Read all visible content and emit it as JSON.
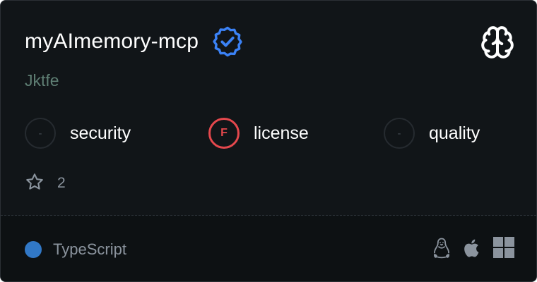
{
  "server": {
    "name": "myAImemory-mcp",
    "author": "Jktfe",
    "verified_icon": "verified-badge-icon",
    "category_icon": "brain-icon"
  },
  "scores": [
    {
      "grade": "-",
      "label": "security"
    },
    {
      "grade": "F",
      "label": "license"
    },
    {
      "grade": "-",
      "label": "quality"
    }
  ],
  "stars": {
    "icon": "star-icon",
    "count": "2"
  },
  "footer": {
    "language": "TypeScript",
    "language_color": "#3178c6",
    "platforms": [
      "linux-icon",
      "apple-icon",
      "windows-icon"
    ]
  },
  "colors": {
    "background": "#111518",
    "verified": "#3b82f6",
    "fail": "#e5484d",
    "author": "#5f7f74"
  }
}
